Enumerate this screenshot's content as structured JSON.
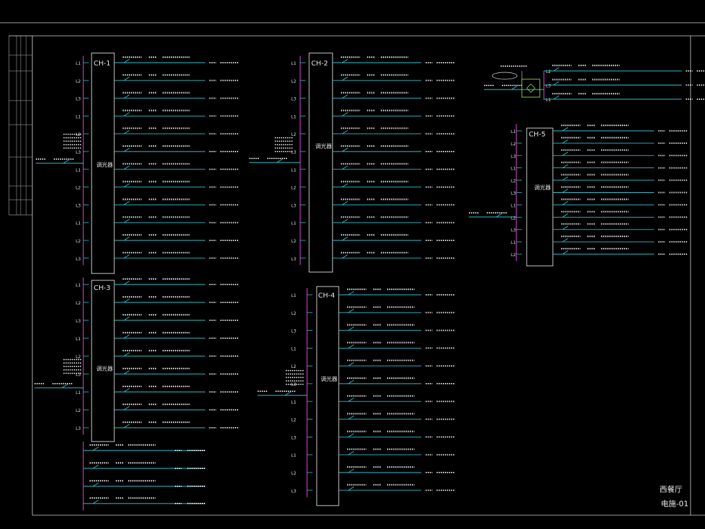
{
  "drawing": {
    "title": "西餐厅",
    "number": "电施-01"
  },
  "panels": [
    {
      "id": "ch1",
      "name": "CH-1",
      "device": "调光器",
      "phases": [
        "L1",
        "L2",
        "L3",
        "L1",
        "L2",
        "L3",
        "L1",
        "L2",
        "L3",
        "L1",
        "L2",
        "L3"
      ]
    },
    {
      "id": "ch2",
      "name": "CH-2",
      "device": "调光器",
      "phases": [
        "L1",
        "L2",
        "L3",
        "L1",
        "L2",
        "L3",
        "L1",
        "L2",
        "L3",
        "L1",
        "L2",
        "L3"
      ]
    },
    {
      "id": "ch3",
      "name": "CH-3",
      "device": "调光器",
      "phases": [
        "L1",
        "L2",
        "L3",
        "L1",
        "L2",
        "L3",
        "L1",
        "L2",
        "L3"
      ]
    },
    {
      "id": "ch4",
      "name": "CH-4",
      "device": "调光器",
      "phases": [
        "L1",
        "L2",
        "L3",
        "L1",
        "L2",
        "L3",
        "L1",
        "L2",
        "L3",
        "L1",
        "L2",
        "L3"
      ]
    },
    {
      "id": "ch5",
      "name": "CH-5",
      "device": "调光器",
      "phases": [
        "L1",
        "L2",
        "L3",
        "L1",
        "L2",
        "L3",
        "L1",
        "L2",
        "L3",
        "L1",
        "L2"
      ]
    },
    {
      "id": "top",
      "name": "",
      "device": "",
      "phases": [
        "L2",
        "L3",
        "L1"
      ]
    }
  ],
  "colors": {
    "background": "#000000",
    "frame": "#d8d8d8",
    "busbar": "#c040c0",
    "feeder": "#2fc7d4",
    "panel_box": "#e6e6e6",
    "branch_box": "#6be0a0",
    "text": "#e8e8e8",
    "highlight_box": "#8fe04f"
  }
}
